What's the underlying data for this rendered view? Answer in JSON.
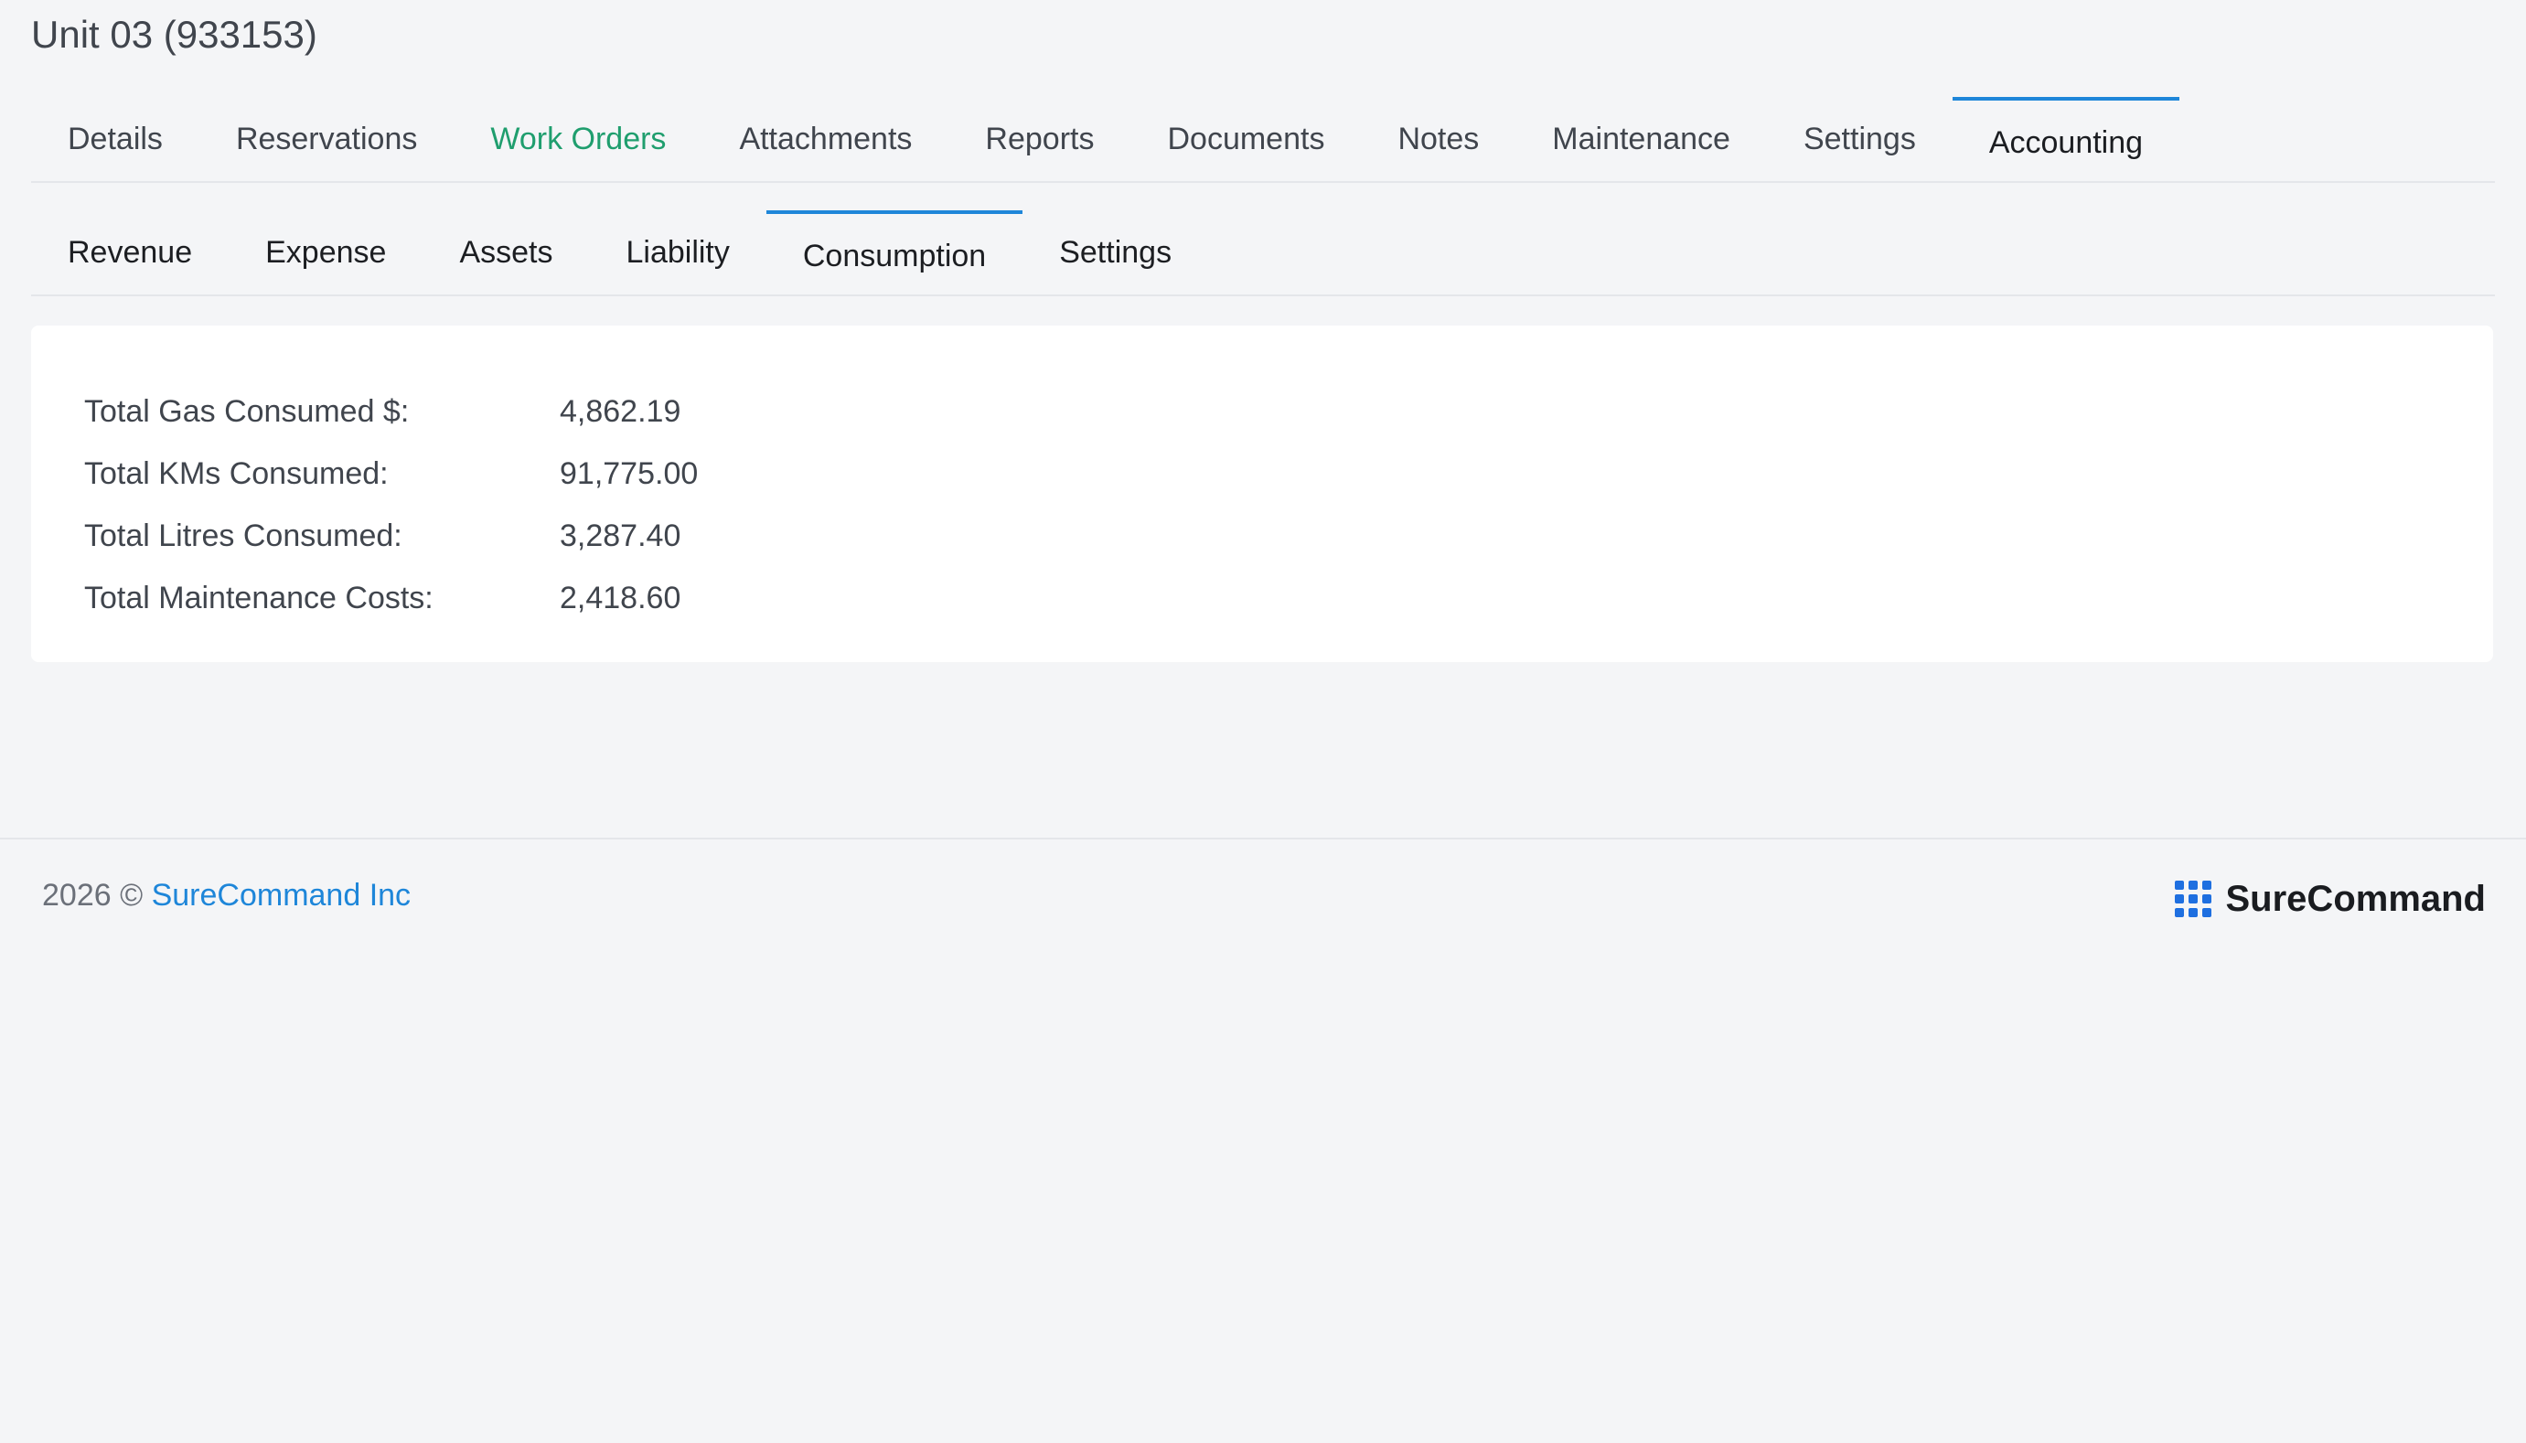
{
  "unit_title": "Unit 03 (933153)",
  "main_tabs": [
    {
      "label": "Details"
    },
    {
      "label": "Reservations"
    },
    {
      "label": "Work Orders"
    },
    {
      "label": "Attachments"
    },
    {
      "label": "Reports"
    },
    {
      "label": "Documents"
    },
    {
      "label": "Notes"
    },
    {
      "label": "Maintenance"
    },
    {
      "label": "Settings"
    },
    {
      "label": "Accounting"
    }
  ],
  "main_tabs_active": "Accounting",
  "sub_tabs": [
    {
      "label": "Revenue"
    },
    {
      "label": "Expense"
    },
    {
      "label": "Assets"
    },
    {
      "label": "Liability"
    },
    {
      "label": "Consumption"
    },
    {
      "label": "Settings"
    }
  ],
  "sub_tabs_active": "Consumption",
  "stats": [
    {
      "label": "Total Gas Consumed $:",
      "value": "4,862.19"
    },
    {
      "label": "Total KMs Consumed:",
      "value": "91,775.00"
    },
    {
      "label": "Total Litres Consumed:",
      "value": "3,287.40"
    },
    {
      "label": "Total Maintenance Costs:",
      "value": "2,418.60"
    }
  ],
  "footer": {
    "copyright": "2026 ©",
    "company_link": "SureCommand Inc"
  },
  "brand": {
    "name": "SureCommand",
    "icon": "grid-dots-icon"
  },
  "colors": {
    "accent": "#1e86d9",
    "green_tab": "#1f9e6e",
    "brand_icon": "#1e6fe0"
  }
}
